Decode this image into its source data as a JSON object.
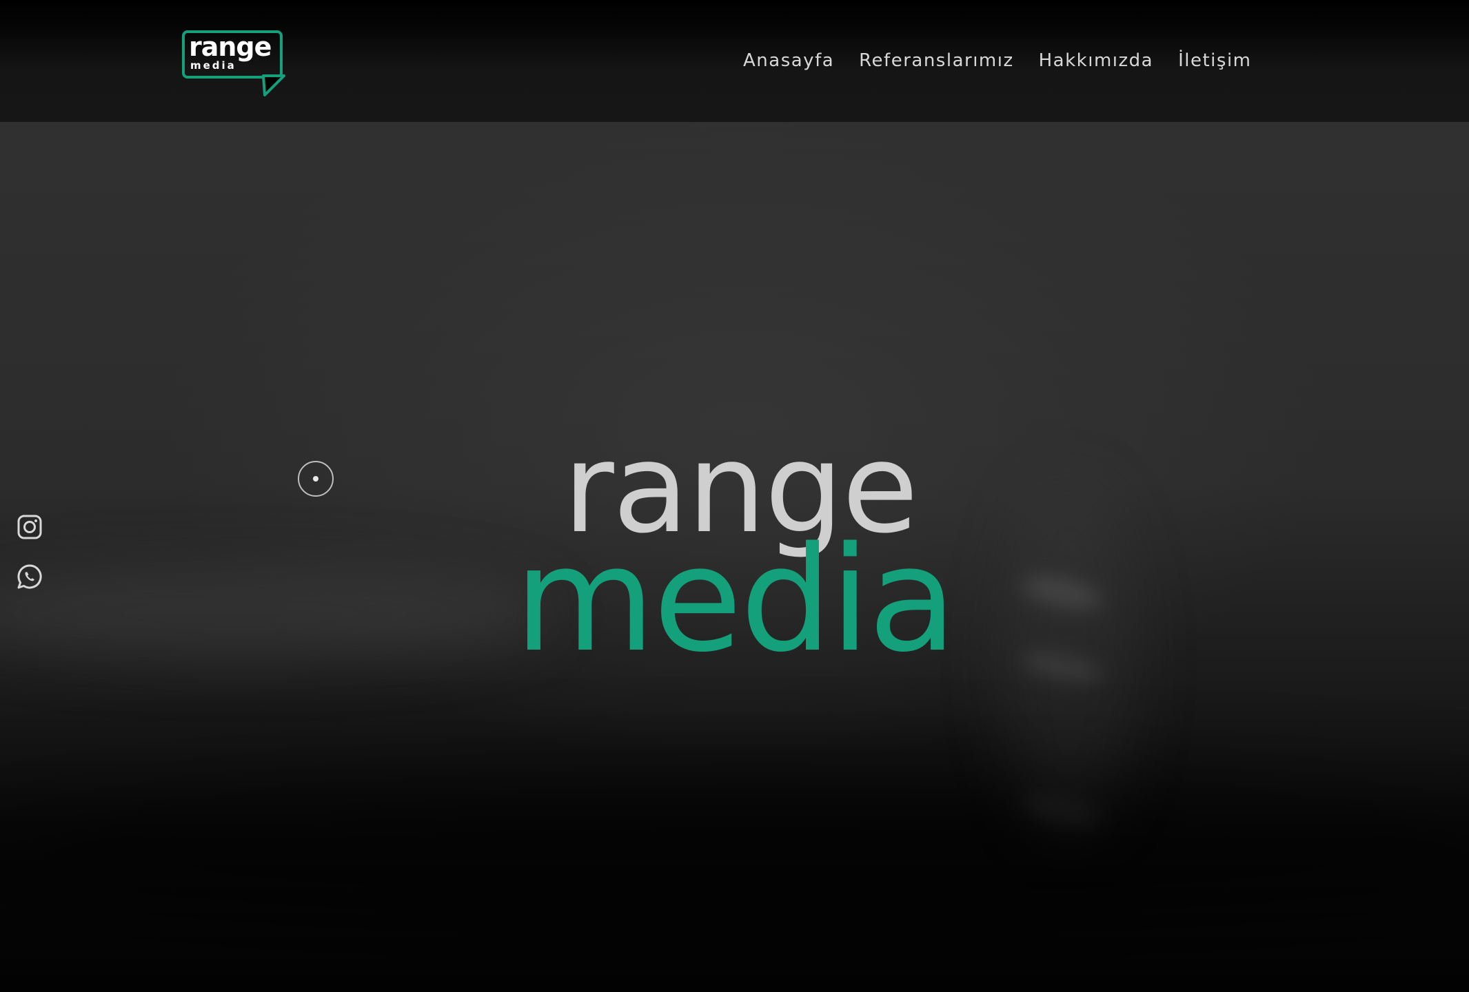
{
  "brand": {
    "logo_word_top": "range",
    "logo_word_bottom": "media",
    "accent_color": "#13a07b"
  },
  "nav": {
    "items": [
      {
        "label": "Anasayfa"
      },
      {
        "label": "Referanslarımız"
      },
      {
        "label": "Hakkımızda"
      },
      {
        "label": "İletişim"
      }
    ]
  },
  "social": {
    "items": [
      {
        "icon": "instagram-icon"
      },
      {
        "icon": "whatsapp-icon"
      }
    ]
  },
  "hero": {
    "title_top": "range",
    "title_bottom": "media",
    "title_top_color": "#cfcfcf",
    "title_bottom_color": "#13a07b"
  }
}
